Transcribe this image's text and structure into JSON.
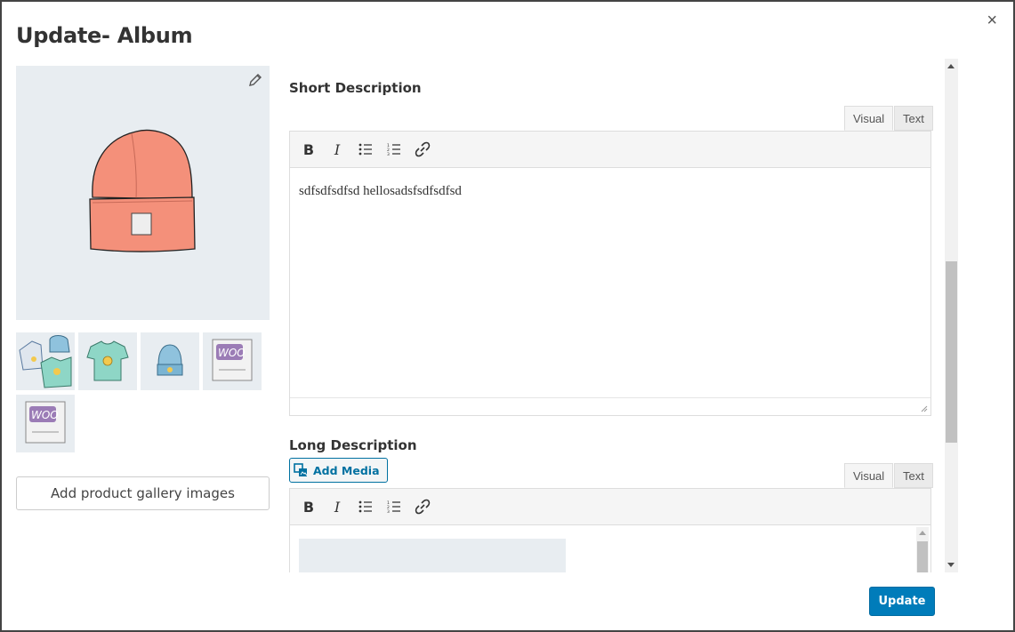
{
  "modal": {
    "title": "Update- Album",
    "close_label": "×"
  },
  "gallery": {
    "add_button_label": "Add product gallery images",
    "thumbnails": [
      {
        "icon": "hoodie-and-shirts-icon"
      },
      {
        "icon": "tshirt-icon"
      },
      {
        "icon": "beanie-icon"
      },
      {
        "icon": "woo-poster-icon"
      },
      {
        "icon": "woo-poster-icon"
      }
    ]
  },
  "short_description": {
    "label": "Short Description",
    "tabs": {
      "visual": "Visual",
      "text": "Text"
    },
    "content": "sdfsdfsdfsd hellosadsfsdfsdfsd"
  },
  "long_description": {
    "label": "Long Description",
    "add_media_label": "Add Media",
    "tabs": {
      "visual": "Visual",
      "text": "Text"
    }
  },
  "footer": {
    "update_label": "Update"
  },
  "colors": {
    "primary": "#007cba",
    "hat": "#f4907a"
  }
}
